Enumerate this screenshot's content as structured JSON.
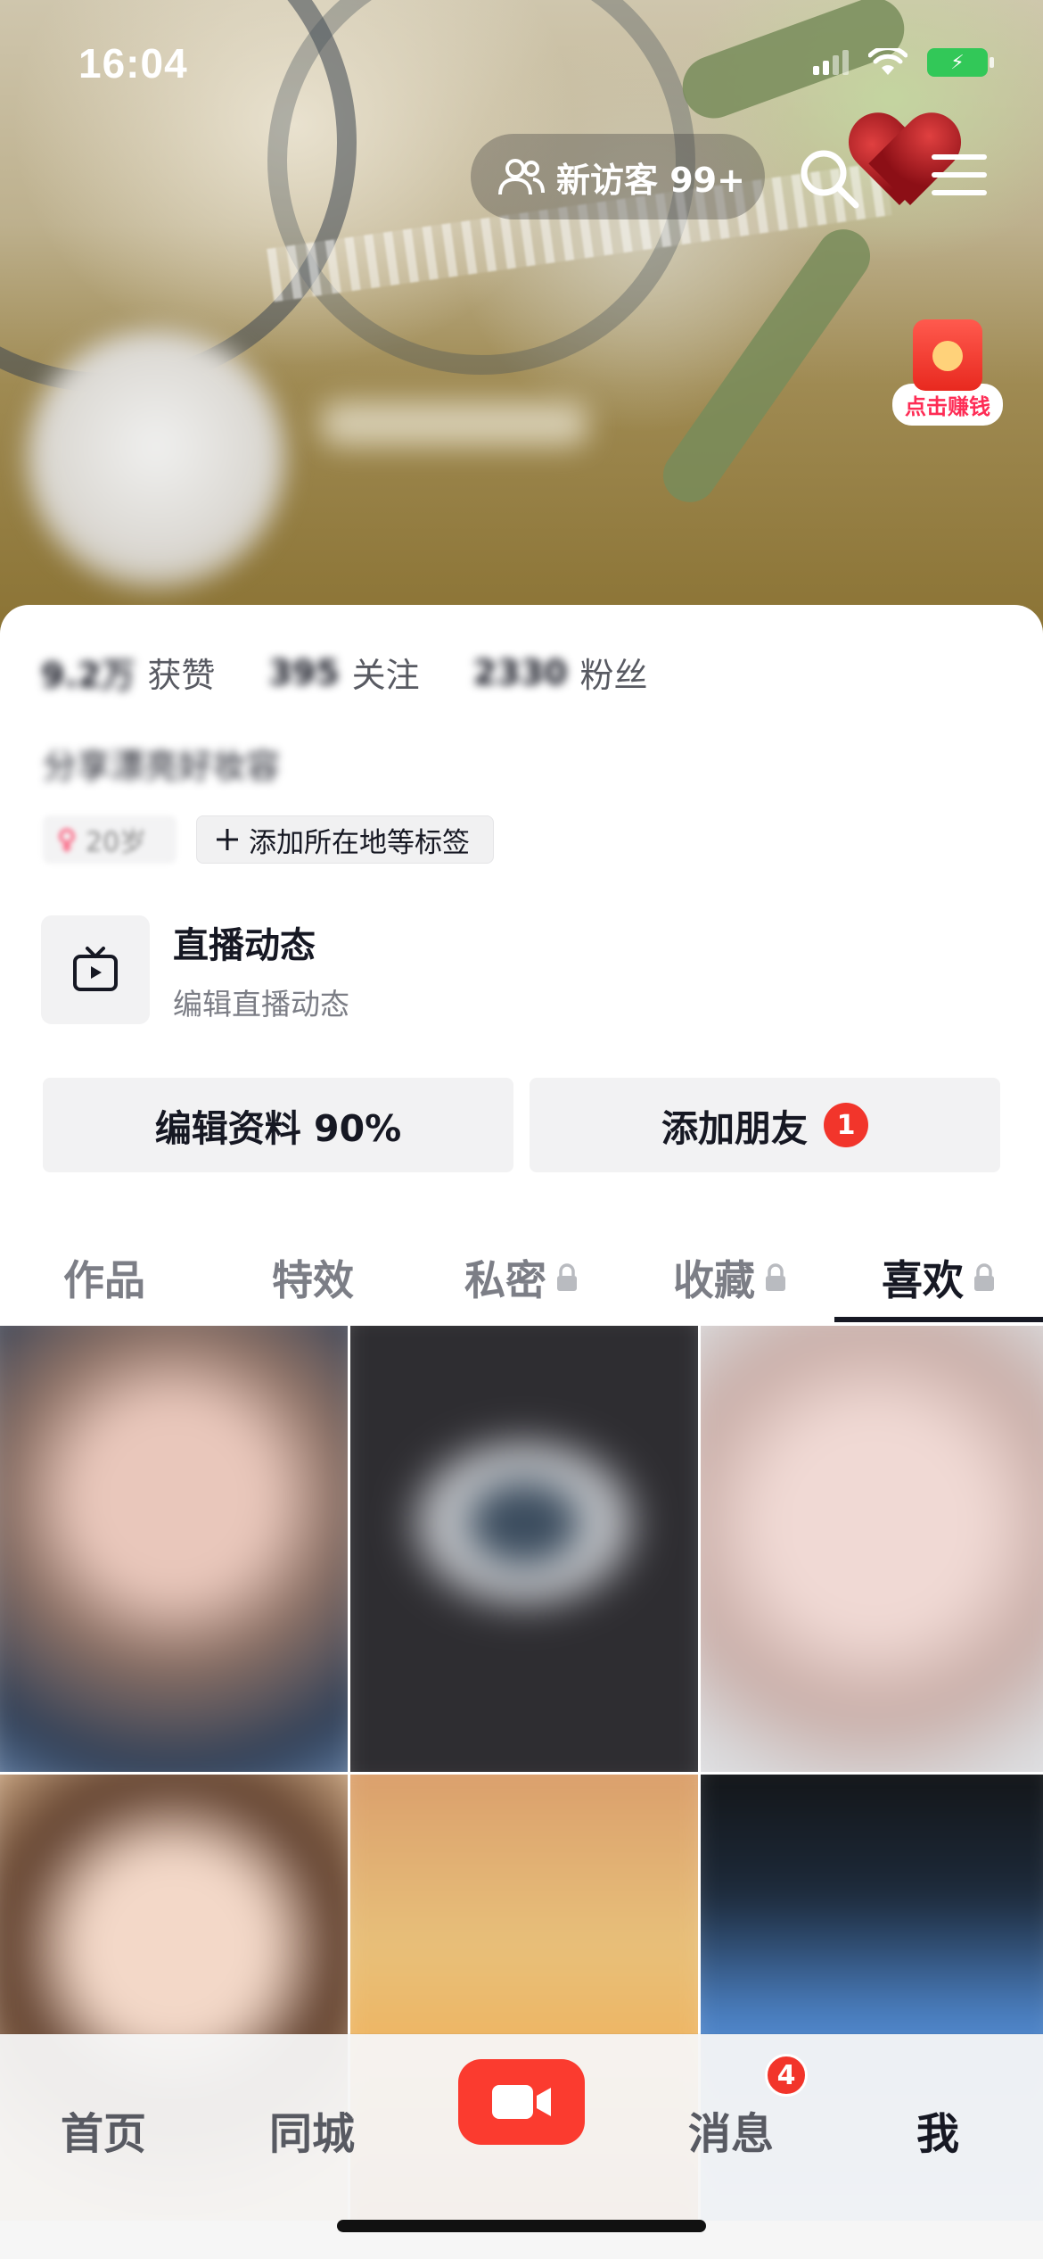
{
  "status_bar": {
    "time": "16:04",
    "signal_icon": "signal-icon",
    "wifi_icon": "wifi-icon",
    "battery_icon": "battery-charging-icon",
    "battery_color": "#32c858"
  },
  "header": {
    "visitors_label": "新访客 99+",
    "visitors_icon": "people-icon",
    "search_icon": "search-icon",
    "menu_icon": "menu-icon",
    "redpacket_label": "点击赚钱"
  },
  "profile": {
    "stats": [
      {
        "value": "9.2万",
        "label": "获赞"
      },
      {
        "value": "395",
        "label": "关注"
      },
      {
        "value": "2330",
        "label": "粉丝"
      }
    ],
    "bio": "分享漂亮好妆容",
    "tag_blurred": "20岁",
    "add_tag_label": "添加所在地等标签",
    "live": {
      "title": "直播动态",
      "subtitle": "编辑直播动态"
    },
    "edit_profile_label": "编辑资料 90%",
    "add_friend_label": "添加朋友",
    "add_friend_badge": "1"
  },
  "tabs": [
    {
      "label": "作品",
      "locked": false,
      "active": false
    },
    {
      "label": "特效",
      "locked": false,
      "active": false
    },
    {
      "label": "私密",
      "locked": true,
      "active": false
    },
    {
      "label": "收藏",
      "locked": true,
      "active": false
    },
    {
      "label": "喜欢",
      "locked": true,
      "active": true
    }
  ],
  "bottom_nav": {
    "home": "首页",
    "nearby": "同城",
    "messages": "消息",
    "messages_badge": "4",
    "me": "我"
  },
  "colors": {
    "accent_red": "#fe2c55",
    "badge_red": "#f2352b",
    "text_primary": "#161823",
    "text_secondary": "#7c7e86"
  }
}
